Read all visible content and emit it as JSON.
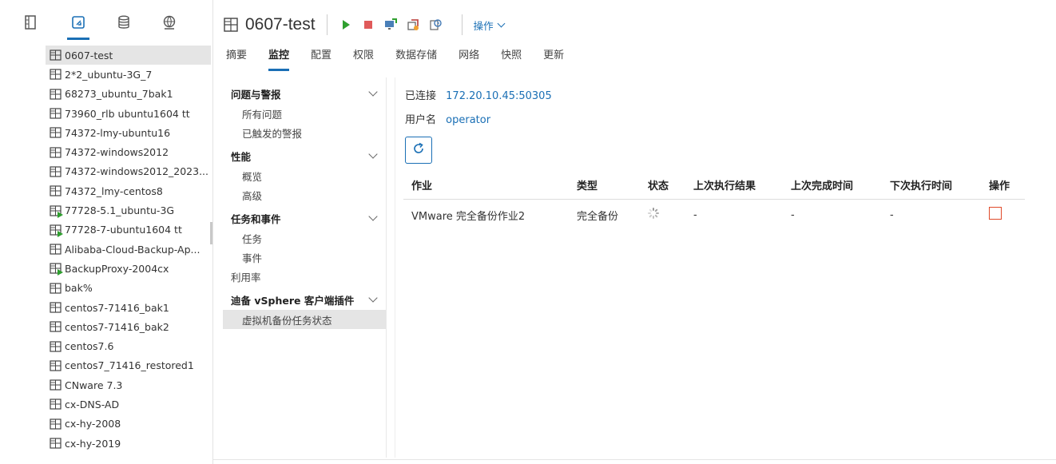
{
  "left_panel": {
    "tabs": [
      {
        "icon": "hosts-clusters-icon"
      },
      {
        "icon": "vms-templates-icon",
        "active": true
      },
      {
        "icon": "storage-icon"
      },
      {
        "icon": "networking-icon"
      }
    ],
    "vms": [
      {
        "name": "0607-test",
        "selected": true,
        "powered_on": false
      },
      {
        "name": "2*2_ubuntu-3G_7",
        "powered_on": false
      },
      {
        "name": "68273_ubuntu_7bak1",
        "powered_on": false
      },
      {
        "name": "73960_rlb ubuntu1604 tt",
        "powered_on": false
      },
      {
        "name": "74372-lmy-ubuntu16",
        "powered_on": false
      },
      {
        "name": "74372-windows2012",
        "powered_on": false
      },
      {
        "name": "74372-windows2012_2023...",
        "powered_on": false
      },
      {
        "name": "74372_lmy-centos8",
        "powered_on": false
      },
      {
        "name": "77728-5.1_ubuntu-3G",
        "powered_on": true
      },
      {
        "name": "77728-7-ubuntu1604 tt",
        "powered_on": true
      },
      {
        "name": "Alibaba-Cloud-Backup-Ap...",
        "powered_on": false
      },
      {
        "name": "BackupProxy-2004cx",
        "powered_on": true
      },
      {
        "name": "bak%",
        "powered_on": false
      },
      {
        "name": "centos7-71416_bak1",
        "powered_on": false
      },
      {
        "name": "centos7-71416_bak2",
        "powered_on": false
      },
      {
        "name": "centos7.6",
        "powered_on": false
      },
      {
        "name": "centos7_71416_restored1",
        "powered_on": false
      },
      {
        "name": "CNware 7.3",
        "powered_on": false
      },
      {
        "name": "cx-DNS-AD",
        "powered_on": false
      },
      {
        "name": "cx-hy-2008",
        "powered_on": false
      },
      {
        "name": "cx-hy-2019",
        "powered_on": false
      }
    ]
  },
  "header": {
    "title": "0607-test",
    "actions_label": "操作",
    "tabs": [
      "摘要",
      "监控",
      "配置",
      "权限",
      "数据存储",
      "网络",
      "快照",
      "更新"
    ],
    "active_tab": "监控"
  },
  "subnav": {
    "group1": "问题与警报",
    "group1_items": [
      "所有问题",
      "已触发的警报"
    ],
    "group2": "性能",
    "group2_items": [
      "概览",
      "高级"
    ],
    "group3": "任务和事件",
    "group3_items": [
      "任务",
      "事件"
    ],
    "utilization": "利用率",
    "group4": "迪备 vSphere 客户端插件",
    "group4_items": [
      "虚拟机备份任务状态"
    ]
  },
  "content": {
    "connected_label": "已连接",
    "connected_value": "172.20.10.45:50305",
    "username_label": "用户名",
    "username_value": "operator",
    "table": {
      "headers": [
        "作业",
        "类型",
        "状态",
        "上次执行结果",
        "上次完成时间",
        "下次执行时间",
        "操作"
      ],
      "rows": [
        {
          "job": "VMware 完全备份作业2",
          "type": "完全备份",
          "status": "running",
          "last_result": "-",
          "last_finish": "-",
          "next_run": "-"
        }
      ]
    }
  },
  "colors": {
    "accent": "#1a6fb5",
    "power_on": "#2e9f2e",
    "danger": "#e04a2a"
  }
}
